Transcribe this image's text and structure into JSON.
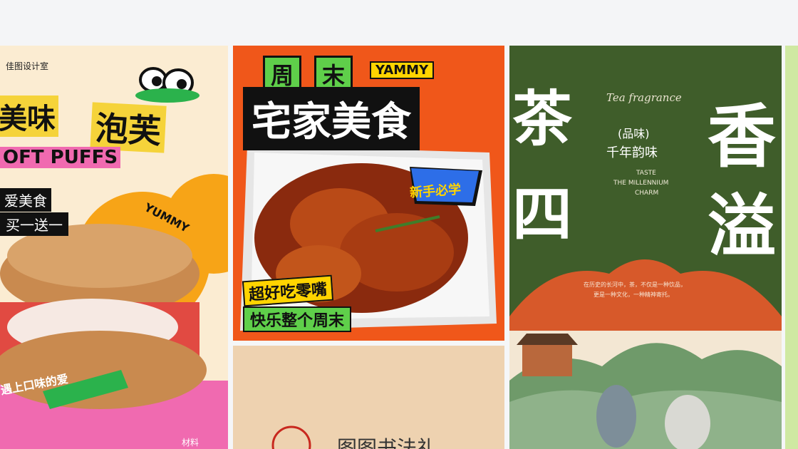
{
  "cards": [
    {
      "studio": "佳图设计室",
      "title_a": "美味",
      "title_b": "泡芙",
      "subtitle": "OFT PUFFS",
      "tag1": "爱美食",
      "tag2": "买一送一",
      "yummy": "YUMMY",
      "bottom": "遇上口味的爱",
      "bottom2": "材料",
      "colors": {
        "bg": "#fbecd2",
        "yellow": "#f5d33a",
        "orange": "#f7a417",
        "pink": "#f06ab0",
        "green": "#2bb24c"
      }
    },
    {
      "title_top_a": "周",
      "title_top_b": "末",
      "yammy": "YAMMY",
      "title_main": "宅家美食",
      "badge": "新手必学",
      "line1": "超好吃零嘴",
      "line2": "快乐整个周末",
      "colors": {
        "bg": "#f0571a",
        "black": "#111111",
        "yellow": "#ffd400",
        "green": "#5fcf4a"
      }
    },
    {
      "title": "图图书法礼",
      "colors": {
        "bg": "#eed2b0",
        "seal": "#c8281e"
      }
    },
    {
      "char1": "茶",
      "char2": "四",
      "char3": "香",
      "char4": "溢",
      "en": "Tea fragrance",
      "sub1": "(品味)",
      "sub2": "千年韵味",
      "taste1": "TASTE",
      "taste2": "THE MILLENNIUM",
      "taste3": "CHARM",
      "body1": "在历史的长河中，茶，不仅是一种饮品，",
      "body2": "更是一种文化，一种精神寄托。",
      "colors": {
        "bg": "#3f5d2a",
        "arch": "#d7592a",
        "cream": "#f3e7d3"
      }
    }
  ]
}
